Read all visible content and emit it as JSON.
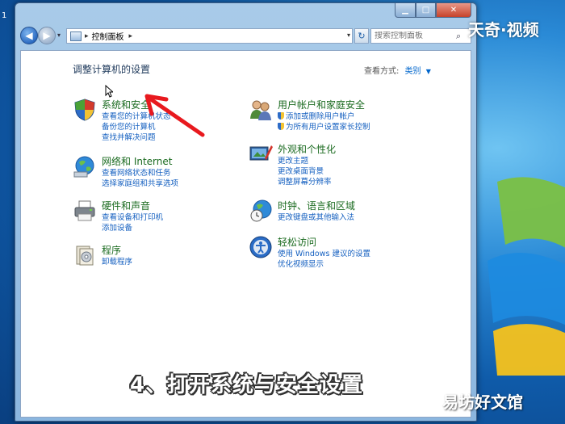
{
  "desktop": {
    "icon_label": "1"
  },
  "window": {
    "caption_buttons": {
      "minimize": "▁",
      "maximize": "□",
      "close": "✕"
    },
    "nav": {
      "back_glyph": "◀",
      "forward_glyph": "▶",
      "dropdown_glyph": "▾",
      "address_path": "控制面板",
      "address_sep": "▸",
      "address_drop": "▾",
      "refresh_glyph": "↻",
      "search_placeholder": "搜索控制面板"
    },
    "content": {
      "page_title": "调整计算机的设置",
      "view_by_label": "查看方式:",
      "view_by_value": "类别",
      "view_by_arrow": "▼",
      "categories_left": [
        {
          "title": "系统和安全",
          "icon": "shield-icon",
          "links": [
            "查看您的计算机状态",
            "备份您的计算机",
            "查找并解决问题"
          ]
        },
        {
          "title": "网络和 Internet",
          "icon": "network-globe-icon",
          "links": [
            "查看网络状态和任务",
            "选择家庭组和共享选项"
          ]
        },
        {
          "title": "硬件和声音",
          "icon": "printer-icon",
          "links": [
            "查看设备和打印机",
            "添加设备"
          ]
        },
        {
          "title": "程序",
          "icon": "programs-icon",
          "links": [
            "卸载程序"
          ]
        }
      ],
      "categories_right": [
        {
          "title": "用户帐户和家庭安全",
          "icon": "users-icon",
          "links": [
            "添加或删除用户帐户",
            "为所有用户设置家长控制"
          ],
          "shield_links": [
            true,
            true
          ]
        },
        {
          "title": "外观和个性化",
          "icon": "appearance-icon",
          "links": [
            "更改主题",
            "更改桌面背景",
            "调整屏幕分辨率"
          ]
        },
        {
          "title": "时钟、语言和区域",
          "icon": "clock-globe-icon",
          "links": [
            "更改键盘或其他输入法"
          ]
        },
        {
          "title": "轻松访问",
          "icon": "ease-of-access-icon",
          "links": [
            "使用 Windows 建议的设置",
            "优化视频显示"
          ]
        }
      ]
    }
  },
  "overlay": {
    "subtitle": "4、打开系统与安全设置",
    "watermark_top": "天奇·视频",
    "watermark_bottom": "易坊好文馆"
  },
  "colors": {
    "category_title": "#1b6b20",
    "link": "#1560c0",
    "annotation_arrow": "#e8191e"
  }
}
